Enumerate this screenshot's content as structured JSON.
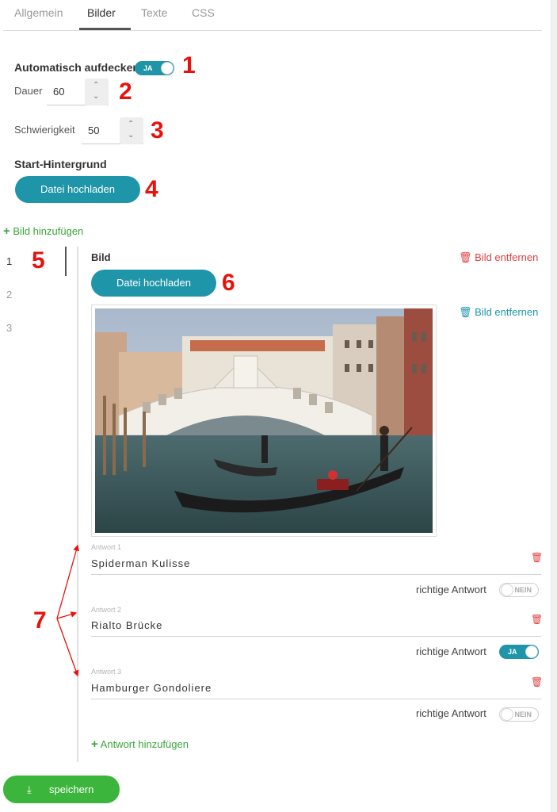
{
  "tabs": [
    {
      "label": "Allgemein",
      "active": false
    },
    {
      "label": "Bilder",
      "active": true
    },
    {
      "label": "Texte",
      "active": false
    },
    {
      "label": "CSS",
      "active": false
    }
  ],
  "settings": {
    "auto_reveal_label": "Automatisch aufdecken",
    "auto_reveal_toggle": "JA",
    "duration_label": "Dauer",
    "duration_value": "60",
    "difficulty_label": "Schwierigkeit",
    "difficulty_value": "50",
    "start_bg_label": "Start-Hintergrund",
    "upload_label": "Datei hochladen"
  },
  "images": {
    "add_label": "Bild hinzufügen",
    "numbers": [
      "1",
      "2",
      "3"
    ],
    "selected": "1",
    "section_label": "Bild",
    "remove_label": "Bild entfernen",
    "upload_label": "Datei hochladen",
    "image_remove_label": "Bild entfernen"
  },
  "answers": [
    {
      "caption": "Antwort 1",
      "value": "Spiderman Kulisse",
      "correct_label": "richtige Antwort",
      "toggle": "NEIN"
    },
    {
      "caption": "Antwort 2",
      "value": "Rialto Brücke",
      "correct_label": "richtige Antwort",
      "toggle": "JA"
    },
    {
      "caption": "Antwort 3",
      "value": "Hamburger Gondoliere",
      "correct_label": "richtige Antwort",
      "toggle": "NEIN"
    }
  ],
  "add_answer_label": "Antwort hinzufügen",
  "save_label": "speichern",
  "annotations": [
    "1",
    "2",
    "3",
    "4",
    "5",
    "6",
    "7"
  ],
  "colors": {
    "accent": "#1f95a9",
    "add": "#3aa63a",
    "danger": "#e04040",
    "save": "#3cb53c",
    "annotation": "#e8120c"
  },
  "icons": [
    "plus-icon",
    "trash-icon",
    "download-icon",
    "chevron-up-icon",
    "chevron-down-icon"
  ]
}
